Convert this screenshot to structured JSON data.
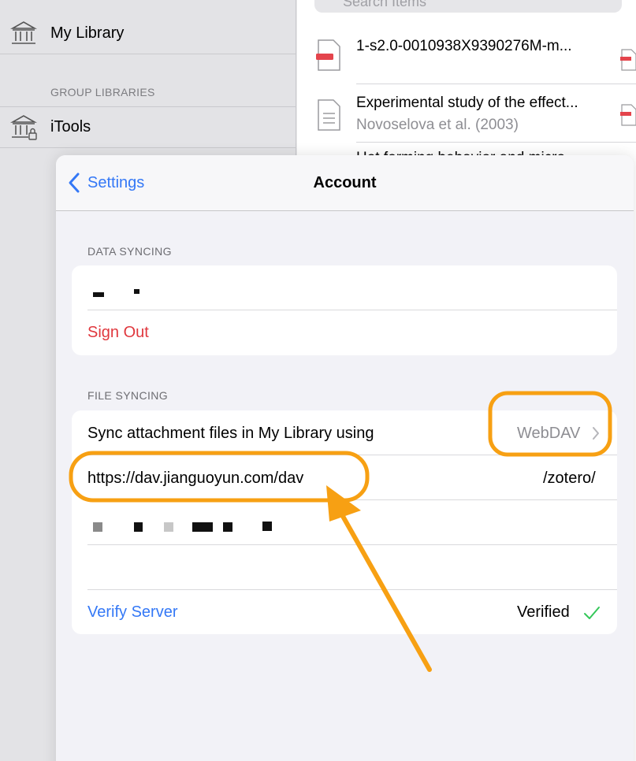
{
  "sidebar": {
    "my_library": "My Library",
    "group_libraries_header": "GROUP LIBRARIES",
    "group": "iTools"
  },
  "items": {
    "search_placeholder": "Search Items",
    "list": [
      {
        "title": "1-s2.0-0010938X9390276M-m...",
        "subtitle": ""
      },
      {
        "title": "Experimental study of the effect...",
        "subtitle": "Novoselova et al. (2003)"
      },
      {
        "title": "Hot forming behavior and micro...",
        "subtitle": ""
      }
    ]
  },
  "sheet": {
    "back_label": "Settings",
    "title": "Account",
    "data_syncing": {
      "header": "DATA SYNCING",
      "sign_out": "Sign Out"
    },
    "file_syncing": {
      "header": "FILE SYNCING",
      "sync_label": "Sync attachment files in My Library using",
      "sync_value": "WebDAV",
      "url": "https://dav.jianguoyun.com/dav",
      "path": "/zotero/",
      "verify_label": "Verify Server",
      "verify_status": "Verified"
    }
  },
  "colors": {
    "accent_blue": "#3478f6",
    "destructive_red": "#e0383e",
    "verified_green": "#34c759",
    "annotation_orange": "#f7a013"
  }
}
